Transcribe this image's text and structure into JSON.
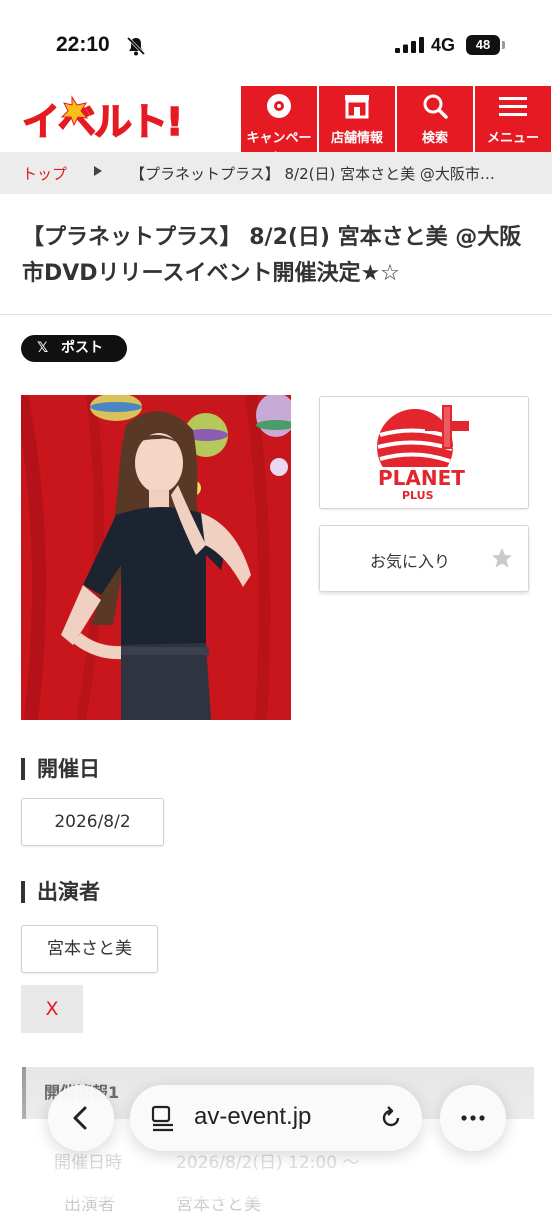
{
  "status_bar": {
    "time": "22:10",
    "network": "4G",
    "battery": "48"
  },
  "header": {
    "logo_text": "イベルト!",
    "nav": [
      {
        "label": "キャンペーン",
        "icon": "disc-icon"
      },
      {
        "label": "店舗情報",
        "icon": "store-icon"
      },
      {
        "label": "検索",
        "icon": "search-icon"
      },
      {
        "label": "メニュー",
        "icon": "menu-icon"
      }
    ],
    "brand_color": "#e51a22"
  },
  "breadcrumb": {
    "home": "トップ",
    "current": "【プラネットプラス】 8/2(日) 宮本さと美 @大阪市…"
  },
  "page": {
    "title": "【プラネットプラス】 8/2(日) 宮本さと美 @大阪市DVDリリースイベント開催決定★☆",
    "x_post_label": "ポスト",
    "favorite_label": "お気に入り",
    "brand_logo": {
      "line1": "PLANET",
      "line2": "PLUS"
    }
  },
  "sections": {
    "date_heading": "開催日",
    "date_value": "2026/8/2",
    "performer_heading": "出演者",
    "performer_name": "宮本さと美",
    "x_link": "X"
  },
  "info": {
    "heading": "開催情報1",
    "row1_label": "開催日時",
    "row1_value": "2026/8/2(日) 12:00 〜",
    "row2_label": "出演者",
    "row2_value": "宮本さと美"
  },
  "browser": {
    "url": "av-event.jp"
  }
}
